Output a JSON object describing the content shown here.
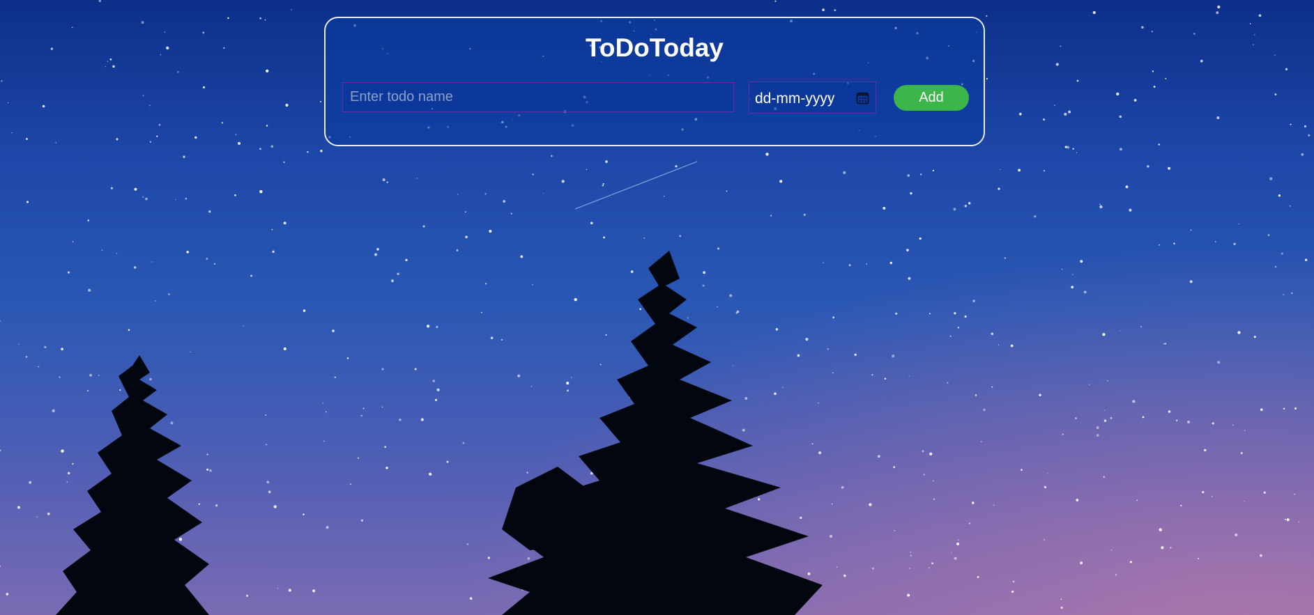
{
  "app": {
    "title": "ToDoToday"
  },
  "form": {
    "todo_placeholder": "Enter todo name",
    "todo_value": "",
    "date_placeholder": "dd-mm-yyyy",
    "add_label": "Add"
  },
  "icons": {
    "date_picker": "calendar-icon"
  },
  "colors": {
    "accent_button": "#3cb54a",
    "input_border": "#6a2aa0",
    "card_border": "#e8eefc",
    "title_text": "#ffffff"
  }
}
